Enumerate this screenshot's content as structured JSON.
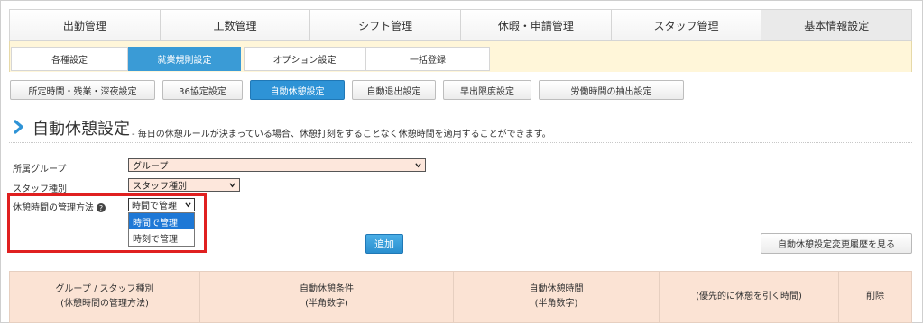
{
  "main_tabs": [
    {
      "label": "出勤管理"
    },
    {
      "label": "工数管理"
    },
    {
      "label": "シフト管理"
    },
    {
      "label": "休暇・申請管理"
    },
    {
      "label": "スタッフ管理"
    },
    {
      "label": "基本情報設定"
    }
  ],
  "sub_tabs": [
    {
      "label": "各種設定"
    },
    {
      "label": "就業規則設定"
    },
    {
      "label": "オプション設定"
    },
    {
      "label": "一括登録"
    }
  ],
  "third_tabs": [
    {
      "label": "所定時間・残業・深夜設定"
    },
    {
      "label": "36協定設定"
    },
    {
      "label": "自動休憩設定"
    },
    {
      "label": "自動退出設定"
    },
    {
      "label": "早出限度設定"
    },
    {
      "label": "労働時間の抽出設定"
    }
  ],
  "heading": {
    "title": "自動休憩設定",
    "description": "- 毎日の休憩ルールが決まっている場合、休憩打刻をすることなく休憩時間を適用することができます。"
  },
  "form": {
    "group_label": "所属グループ",
    "group_value": "グループ",
    "staff_type_label": "スタッフ種別",
    "staff_type_value": "スタッフ種別",
    "method_label": "休憩時間の管理方法",
    "help_glyph": "?",
    "method_value": "時間で管理",
    "method_options": [
      "時間で管理",
      "時刻で管理"
    ]
  },
  "buttons": {
    "add": "追加",
    "history": "自動休憩設定変更履歴を見る"
  },
  "table": {
    "headers": [
      {
        "line1": "グループ / スタッフ種別",
        "line2": "(休憩時間の管理方法)"
      },
      {
        "line1": "自動休憩条件",
        "line2": "(半角数字)"
      },
      {
        "line1": "自動休憩時間",
        "line2": "(半角数字)"
      },
      {
        "line1": "(優先的に休憩を引く時間)",
        "line2": ""
      },
      {
        "line1": "削除",
        "line2": ""
      }
    ]
  },
  "colors": {
    "accent_blue": "#2e93d6",
    "highlight_red": "#e02020",
    "select_bg": "#fde7dc",
    "sub_band_bg": "#fff6d9",
    "table_head_bg": "#fbe3d4"
  }
}
